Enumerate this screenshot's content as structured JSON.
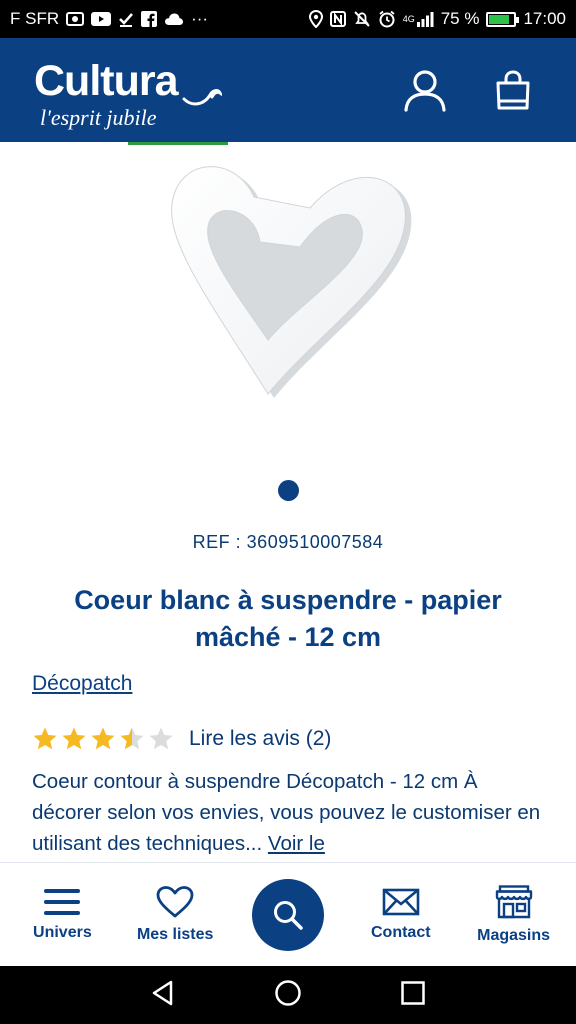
{
  "status_bar": {
    "carrier": "F SFR",
    "network": "4G",
    "battery_percent": "75 %",
    "battery_level": 0.75,
    "time": "17:00",
    "overflow": "···"
  },
  "header": {
    "logo_name": "Cultura",
    "logo_tagline": "l'esprit jubile",
    "account_icon": "user-icon",
    "cart_icon": "shopping-bag-icon"
  },
  "product": {
    "image_icon": "heart-product-image",
    "image_count": 1,
    "ref": "REF : 3609510007584",
    "title": "Coeur blanc à suspendre - papier mâché - 12 cm",
    "brand": "Décopatch",
    "rating": 3.5,
    "rating_max": 5,
    "reviews_label": "Lire les avis (2)",
    "description": "Coeur contour à suspendre Décopatch - 12 cm À décorer selon vos envies, vous pouvez le customiser en utilisant des techniques...",
    "read_more": "Voir le"
  },
  "bottom_nav": {
    "items": [
      {
        "label": "Univers",
        "icon": "menu-icon"
      },
      {
        "label": "Mes listes",
        "icon": "heart-icon"
      },
      {
        "label": "",
        "icon": "search-icon"
      },
      {
        "label": "Contact",
        "icon": "mail-icon"
      },
      {
        "label": "Magasins",
        "icon": "store-icon"
      }
    ]
  },
  "colors": {
    "brand_blue": "#0b4083",
    "star_yellow": "#f5b921",
    "star_grey": "#dcdcdc",
    "accent_green": "#2f9a3e"
  }
}
